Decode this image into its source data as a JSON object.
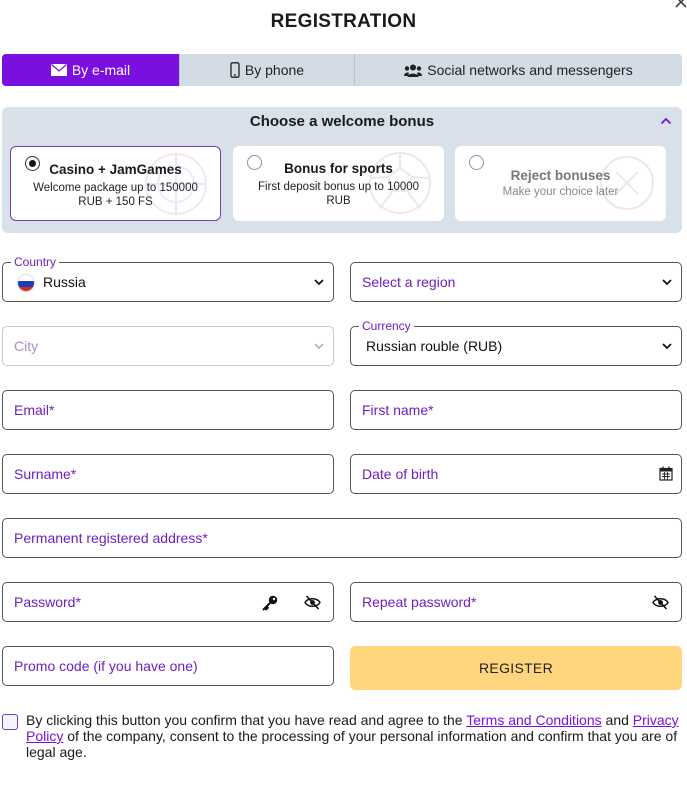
{
  "page": {
    "title": "REGISTRATION"
  },
  "tabs": [
    {
      "label": "By e-mail",
      "icon": "envelope-icon",
      "active": true
    },
    {
      "label": "By phone",
      "icon": "phone-icon",
      "active": false
    },
    {
      "label": "Social networks and messengers",
      "icon": "users-icon",
      "active": false
    }
  ],
  "bonus": {
    "heading": "Choose a welcome bonus",
    "options": [
      {
        "title": "Casino + JamGames",
        "subtitle": "Welcome package up to 150000 RUB + 150 FS",
        "selected": true
      },
      {
        "title": "Bonus for sports",
        "subtitle": "First deposit bonus up to 10000 RUB",
        "selected": false
      },
      {
        "title": "Reject bonuses",
        "subtitle": "Make your choice later",
        "selected": false
      }
    ]
  },
  "form": {
    "country": {
      "label": "Country",
      "value": "Russia"
    },
    "region": {
      "placeholder": "Select a region"
    },
    "city": {
      "placeholder": "City"
    },
    "currency": {
      "label": "Currency",
      "value": "Russian rouble (RUB)"
    },
    "email": {
      "placeholder": "Email*"
    },
    "first_name": {
      "placeholder": "First name*"
    },
    "surname": {
      "placeholder": "Surname*"
    },
    "dob": {
      "placeholder": "Date of birth"
    },
    "address": {
      "placeholder": "Permanent registered address*"
    },
    "password": {
      "placeholder": "Password*"
    },
    "repeat_password": {
      "placeholder": "Repeat password*"
    },
    "promo": {
      "placeholder": "Promo code (if you have one)"
    },
    "register_label": "REGISTER"
  },
  "consent": {
    "text_1": "By clicking this button you confirm that you have read and agree to the ",
    "terms_link": "Terms and Conditions",
    "text_2": " and ",
    "privacy_link": "Privacy Policy",
    "text_3": " of the company, consent to the processing of your personal information and confirm that you are of legal age."
  },
  "colors": {
    "accent": "#7a10e0",
    "register_bg": "#ffd57e",
    "panel_bg": "#d8e0e9"
  }
}
